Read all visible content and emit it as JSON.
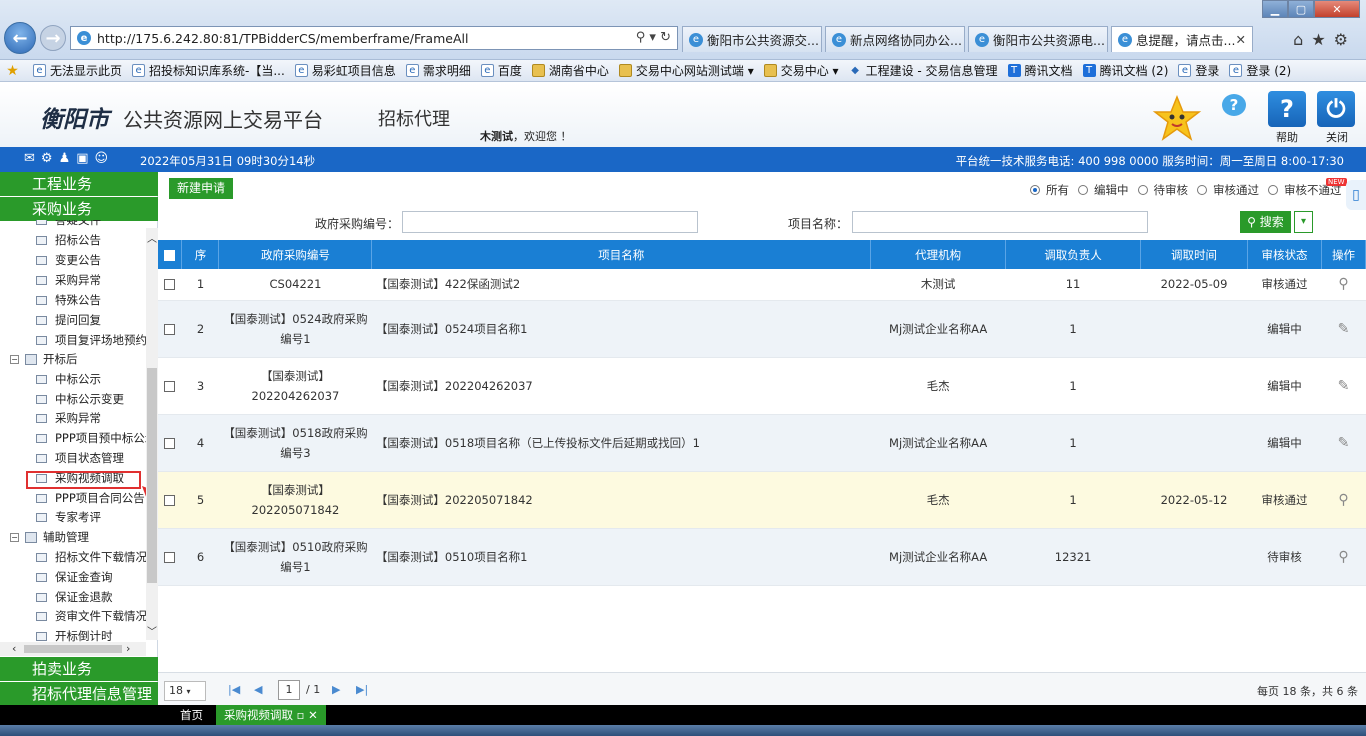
{
  "browser": {
    "address": "http://175.6.242.80:81/TPBidderCS/memberframe/FrameAll",
    "tabs": [
      "衡阳市公共资源交...",
      "新点网络协同办公...",
      "衡阳市公共资源电...",
      "息提醒，请点击..."
    ],
    "favorites": [
      "无法显示此页",
      "招投标知识库系统-【当...",
      "易彩虹项目信息",
      "需求明细",
      "百度",
      "湖南省中心",
      "交易中心网站测试端",
      "交易中心",
      "工程建设 - 交易信息管理",
      "腾讯文档",
      "腾讯文档 (2)",
      "登录",
      "登录 (2)"
    ]
  },
  "header": {
    "city": "衡阳市",
    "platform": "公共资源网上交易平台",
    "system": "招标代理",
    "welcome_user": "木测试",
    "welcome_suffix": "，欢迎您 ！",
    "help_label": "帮助",
    "close_label": "关闭"
  },
  "statusbar": {
    "datetime": "2022年05月31日 09时30分14秒",
    "service": "平台统一技术服务电话: 400 998 0000 服务时间：周一至周日 8:00-17:30"
  },
  "sidebar": {
    "sections": [
      "工程业务",
      "采购业务"
    ],
    "bottom_sections": [
      "拍卖业务",
      "招标代理信息管理"
    ],
    "tree": [
      {
        "label": "答疑文件",
        "type": "leaf"
      },
      {
        "label": "招标公告",
        "type": "leaf"
      },
      {
        "label": "变更公告",
        "type": "leaf"
      },
      {
        "label": "采购异常",
        "type": "leaf"
      },
      {
        "label": "特殊公告",
        "type": "leaf"
      },
      {
        "label": "提问回复",
        "type": "leaf"
      },
      {
        "label": "项目复评场地预约",
        "type": "leaf"
      },
      {
        "label": "开标后",
        "type": "group"
      },
      {
        "label": "中标公示",
        "type": "leaf"
      },
      {
        "label": "中标公示变更",
        "type": "leaf"
      },
      {
        "label": "采购异常",
        "type": "leaf"
      },
      {
        "label": "PPP项目预中标公示",
        "type": "leaf"
      },
      {
        "label": "项目状态管理",
        "type": "leaf"
      },
      {
        "label": "采购视频调取",
        "type": "leaf"
      },
      {
        "label": "PPP项目合同公告",
        "type": "leaf"
      },
      {
        "label": "专家考评",
        "type": "leaf"
      },
      {
        "label": "辅助管理",
        "type": "group"
      },
      {
        "label": "招标文件下载情况",
        "type": "leaf"
      },
      {
        "label": "保证金查询",
        "type": "leaf"
      },
      {
        "label": "保证金退款",
        "type": "leaf"
      },
      {
        "label": "资审文件下载情况",
        "type": "leaf"
      },
      {
        "label": "开标倒计时",
        "type": "leaf"
      }
    ]
  },
  "toolbar": {
    "new_button": "新建申请",
    "filters": [
      "所有",
      "编辑中",
      "待审核",
      "审核通过",
      "审核不通过"
    ],
    "selected_filter": "所有",
    "gov_label": "政府采购编号：",
    "project_label": "项目名称：",
    "search_button": "搜索"
  },
  "table": {
    "headers": [
      "序",
      "政府采购编号",
      "项目名称",
      "代理机构",
      "调取负责人",
      "调取时间",
      "审核状态",
      "操作"
    ],
    "rows": [
      {
        "no": "1",
        "code": "CS04221",
        "name": "【国泰测试】422保函测试2",
        "agency": "木测试",
        "owner": "11",
        "time": "2022-05-09",
        "status": "审核通过",
        "op": "view"
      },
      {
        "no": "2",
        "code": "【国泰测试】0524政府采购编号1",
        "name": "【国泰测试】0524项目名称1",
        "agency": "Mj测试企业名称AA",
        "owner": "1",
        "time": "",
        "status": "编辑中",
        "op": "edit"
      },
      {
        "no": "3",
        "code": "【国泰测试】202204262037",
        "name": "【国泰测试】202204262037",
        "agency": "毛杰",
        "owner": "1",
        "time": "",
        "status": "编辑中",
        "op": "edit"
      },
      {
        "no": "4",
        "code": "【国泰测试】0518政府采购编号3",
        "name": "【国泰测试】0518项目名称（已上传投标文件后延期或找回）1",
        "agency": "Mj测试企业名称AA",
        "owner": "1",
        "time": "",
        "status": "编辑中",
        "op": "edit"
      },
      {
        "no": "5",
        "code": "【国泰测试】202205071842",
        "name": "【国泰测试】202205071842",
        "agency": "毛杰",
        "owner": "1",
        "time": "2022-05-12",
        "status": "审核通过",
        "op": "view"
      },
      {
        "no": "6",
        "code": "【国泰测试】0510政府采购编号1",
        "name": "【国泰测试】0510项目名称1",
        "agency": "Mj测试企业名称AA",
        "owner": "12321",
        "time": "",
        "status": "待审核",
        "op": "view"
      }
    ]
  },
  "pager": {
    "page_size": "18",
    "current": "1",
    "total": "/ 1",
    "info": "每页 18 条，共 6 条"
  },
  "bottom_tabs": [
    "首页",
    "采购视频调取"
  ],
  "colors": {
    "green": "#2a9a2a",
    "blue": "#1a67c6",
    "header_blue": "#1a7fd4"
  }
}
